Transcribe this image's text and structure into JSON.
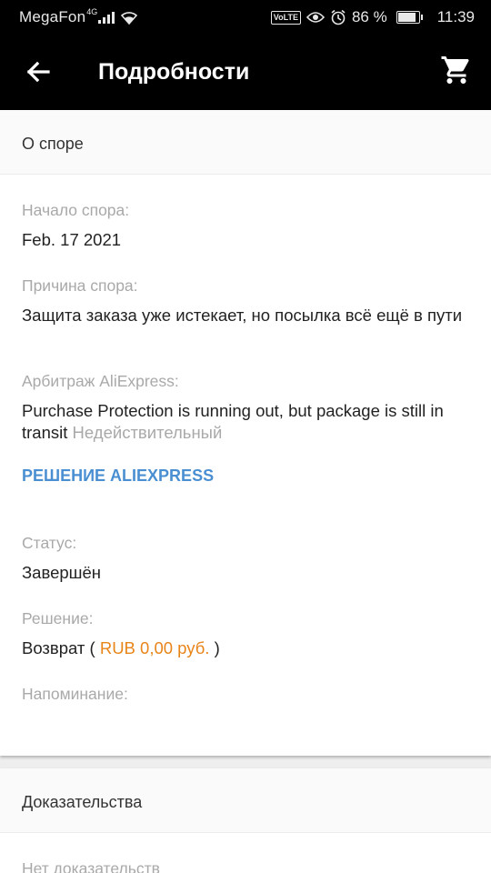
{
  "status_bar": {
    "carrier": "MegaFon",
    "network": "4G",
    "volte": "VoLTE",
    "battery_pct": "86 %",
    "battery_level": 0.86,
    "time": "11:39"
  },
  "app_bar": {
    "title": "Подробности",
    "back_icon": "arrow-back-icon",
    "cart_icon": "cart-icon"
  },
  "dispute": {
    "section_title": "О споре",
    "start_label": "Начало спора:",
    "start_value": "Feb. 17 2021",
    "reason_label": "Причина спора:",
    "reason_value": "Защита заказа уже истекает, но посылка всё ещё в пути",
    "arbitration_label": "Арбитраж AliExpress:",
    "arbitration_value": "Purchase Protection is running out, but package is still in transit",
    "arbitration_status": "Недействительный",
    "decision_link": "РЕШЕНИЕ ALIEXPRESS",
    "status_label": "Статус:",
    "status_value": "Завершён",
    "resolution_label": "Решение:",
    "resolution_prefix": "Возврат (",
    "resolution_amount": "RUB 0,00 руб.",
    "resolution_suffix": ")",
    "reminder_label": "Напоминание:"
  },
  "evidence": {
    "section_title": "Доказательства",
    "empty_text": "Нет доказательств"
  },
  "colors": {
    "accent_link": "#4a8fd1",
    "amount": "#e88518",
    "label_gray": "#a9a9a9"
  }
}
